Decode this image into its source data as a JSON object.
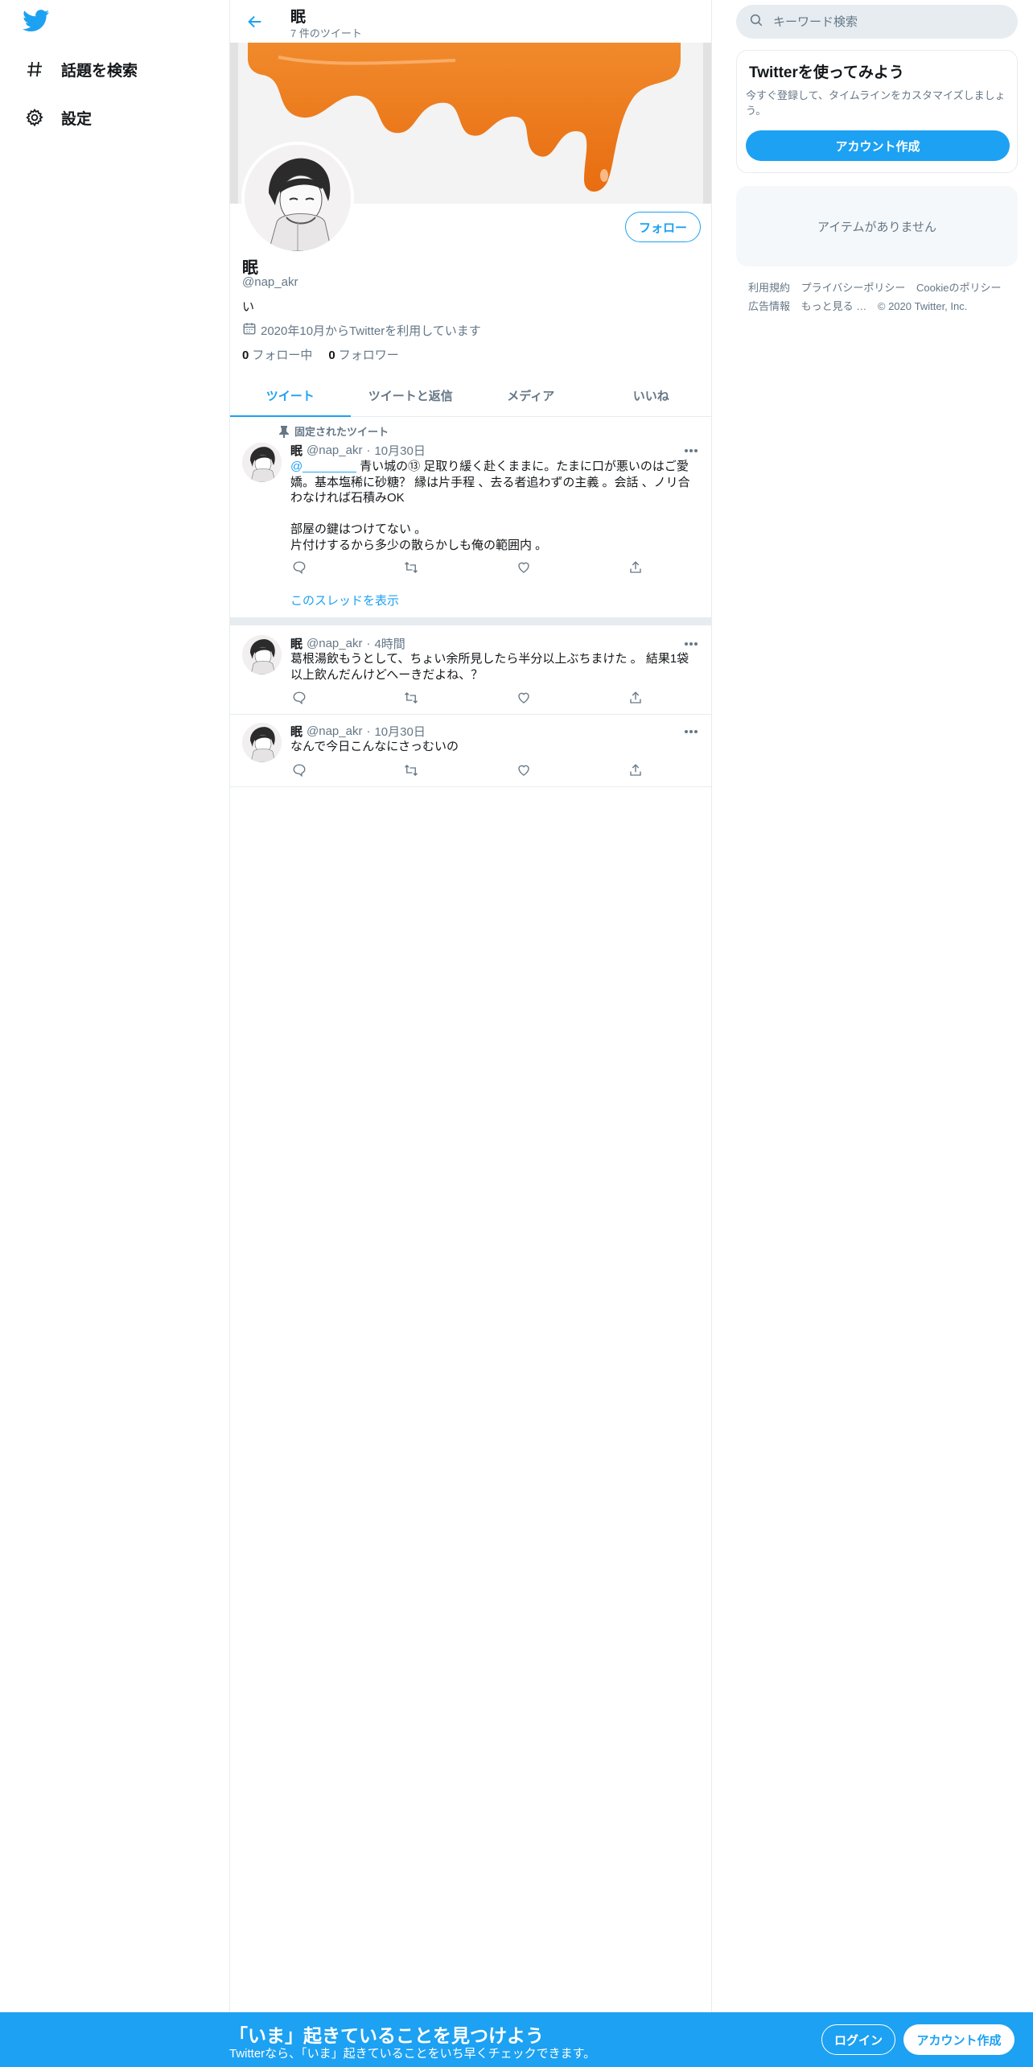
{
  "brand": {
    "accent": "#1da1f2",
    "text": "#14171a",
    "muted": "#657786",
    "border": "#e6ecf0"
  },
  "nav": {
    "logo": "twitter-bird-icon",
    "items": [
      {
        "label": "話題を検索",
        "icon": "hashtag-icon"
      },
      {
        "label": "設定",
        "icon": "gear-icon"
      }
    ]
  },
  "header": {
    "name": "眠",
    "tweet_count": "7 件のツイート"
  },
  "profile": {
    "name": "眠",
    "handle": "@nap_akr",
    "bio": "い",
    "joined": "2020年10月からTwitterを利用しています",
    "following_count": "0",
    "following_label": "フォロー中",
    "followers_count": "0",
    "followers_label": "フォロワー",
    "follow_button": "フォロー"
  },
  "tabs": [
    {
      "label": "ツイート",
      "active": true
    },
    {
      "label": "ツイートと返信",
      "active": false
    },
    {
      "label": "メディア",
      "active": false
    },
    {
      "label": "いいね",
      "active": false
    }
  ],
  "tweets": [
    {
      "pinned_label": "固定されたツイート",
      "name": "眠",
      "handle": "@nap_akr",
      "time": "10月30日",
      "mention": "@________",
      "text": " 青い城の⑬ 足取り緩く赴くままに。たまに口が悪いのはご愛嬌。基本塩稀に砂糖？ 縁は片手程 、去る者追わずの主義 。会話 、ノリ合わなければ石積みOK\n\n部屋の鍵はつけてない 。\n片付けするから多少の散らかしも俺の範囲内 。",
      "thread_link": "このスレッドを表示"
    },
    {
      "name": "眠",
      "handle": "@nap_akr",
      "time": "4時間",
      "text": "葛根湯飲もうとして、ちょい余所見したら半分以上ぶちまけた 。 結果1袋以上飲んだんけどへーきだよね、？"
    },
    {
      "name": "眠",
      "handle": "@nap_akr",
      "time": "10月30日",
      "text": "なんで今日こんなにさっむいの"
    }
  ],
  "right": {
    "search_placeholder": "キーワード検索",
    "signup_title": "Twitterを使ってみよう",
    "signup_desc": "今すぐ登録して、タイムラインをカスタマイズしましょう。",
    "signup_button": "アカウント作成",
    "trends_empty": "アイテムがありません",
    "footer": [
      "利用規約",
      "プライバシーポリシー",
      "Cookieのポリシー",
      "広告情報",
      "もっと見る …",
      "© 2020 Twitter, Inc."
    ]
  },
  "bottom": {
    "title": "「いま」起きていることを見つけよう",
    "subtitle": "Twitterなら、「いま」起きていることをいち早くチェックできます。",
    "login": "ログイン",
    "signup": "アカウント作成"
  }
}
